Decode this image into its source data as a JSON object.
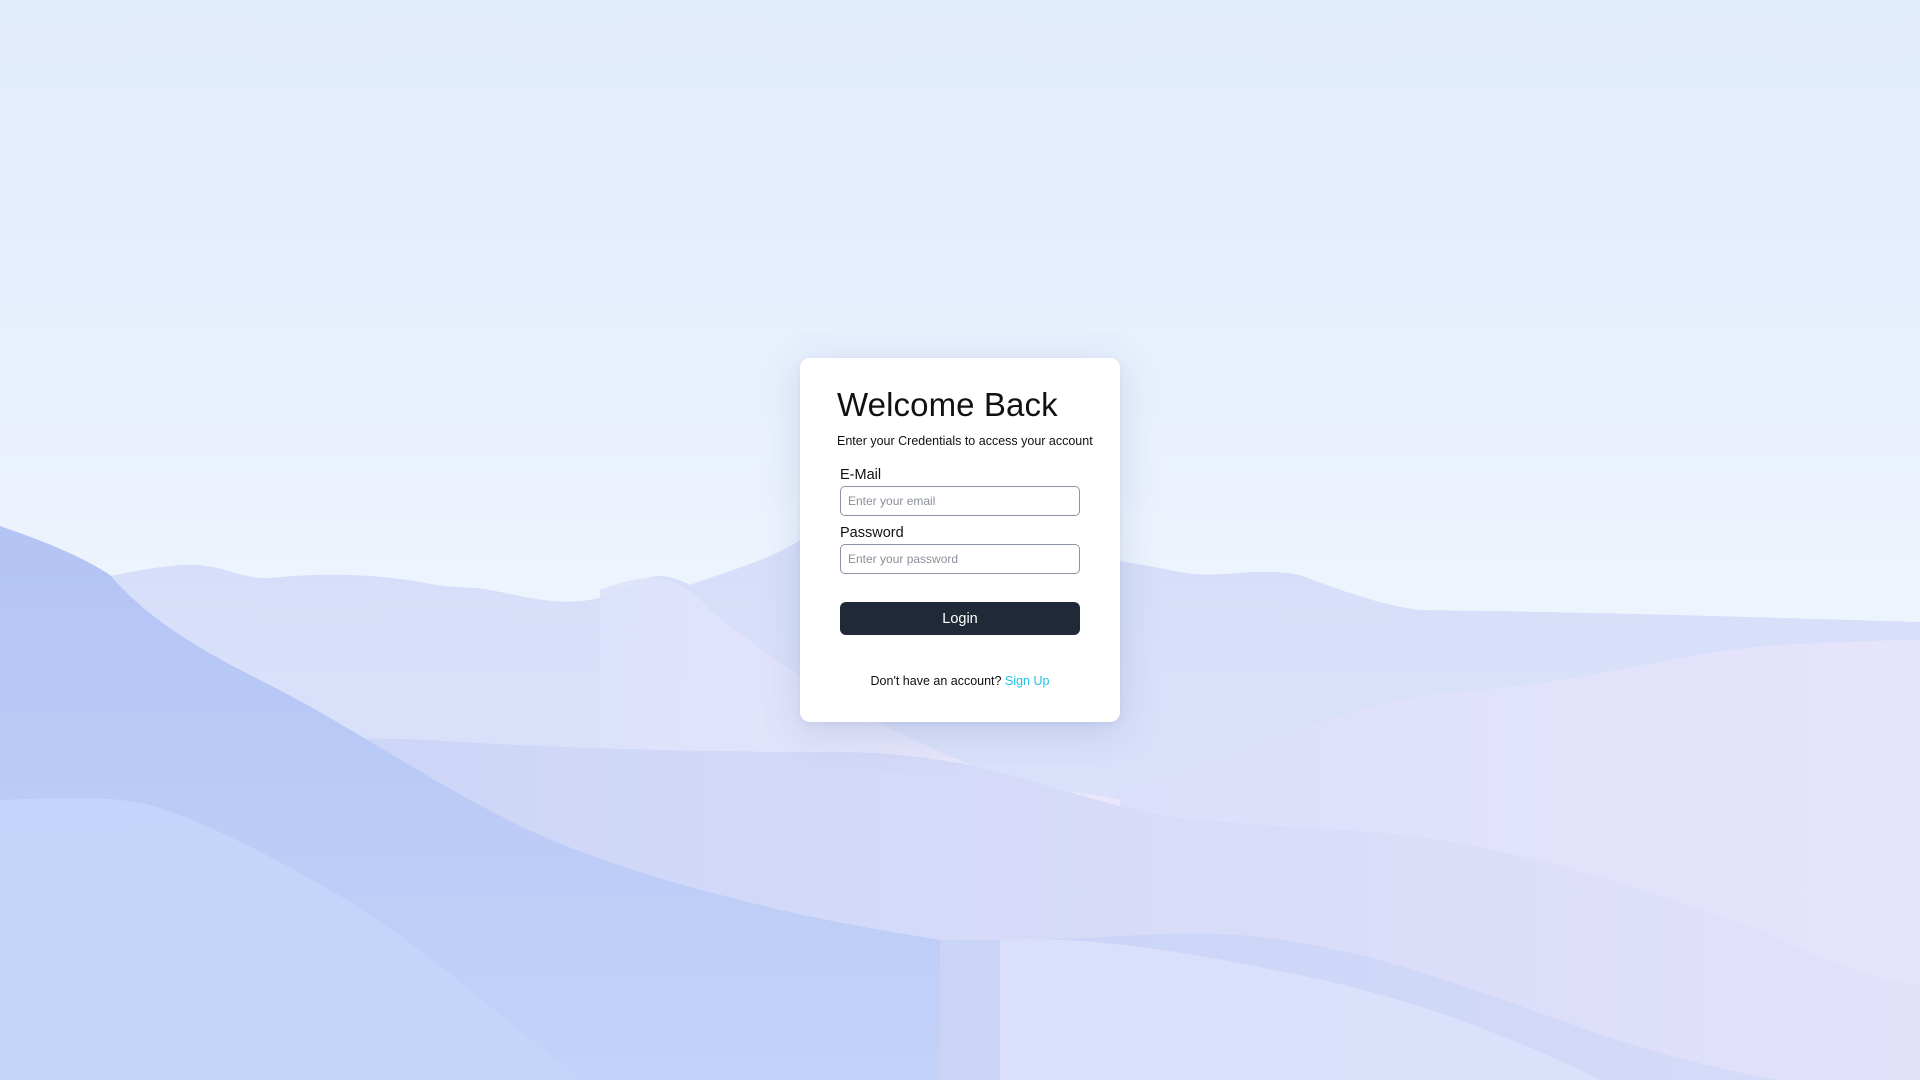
{
  "login": {
    "title": "Welcome Back",
    "subtitle": "Enter your Credentials to access your account",
    "email_label": "E-Mail",
    "email_placeholder": "Enter your email",
    "email_value": "",
    "password_label": "Password",
    "password_placeholder": "Enter your password",
    "password_value": "",
    "login_button": "Login",
    "footer_text": "Don't have an account?",
    "signup_link": "Sign Up"
  },
  "colors": {
    "button_bg": "#1f2937",
    "link": "#22c3e6",
    "background": "#e1ecfc"
  }
}
